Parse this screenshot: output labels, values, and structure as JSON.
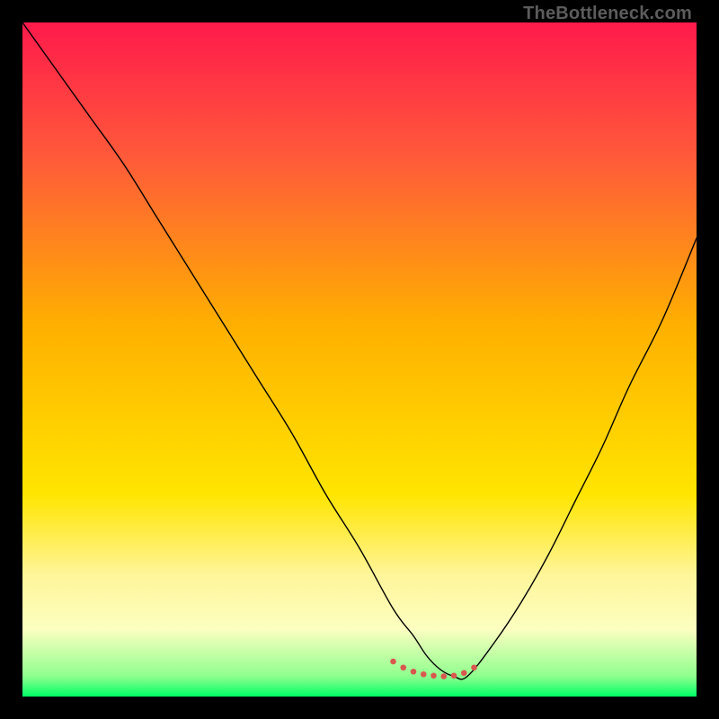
{
  "watermark": "TheBottleneck.com",
  "chart_data": {
    "type": "line",
    "title": "",
    "xlabel": "",
    "ylabel": "",
    "xlim": [
      0,
      100
    ],
    "ylim": [
      0,
      100
    ],
    "grid": false,
    "legend": false,
    "gradient_stops": [
      {
        "offset": 0.0,
        "color": "#ff1a4b"
      },
      {
        "offset": 0.2,
        "color": "#ff5a3a"
      },
      {
        "offset": 0.45,
        "color": "#ffb000"
      },
      {
        "offset": 0.7,
        "color": "#ffe500"
      },
      {
        "offset": 0.82,
        "color": "#fff59a"
      },
      {
        "offset": 0.9,
        "color": "#fcffc0"
      },
      {
        "offset": 0.97,
        "color": "#8fff8f"
      },
      {
        "offset": 1.0,
        "color": "#00ff66"
      }
    ],
    "series": [
      {
        "name": "bottleneck-curve",
        "color": "#000000",
        "width": 1.4,
        "x": [
          0,
          5,
          10,
          15,
          20,
          25,
          30,
          35,
          40,
          45,
          50,
          55,
          58,
          60,
          62,
          64,
          66,
          70,
          74,
          78,
          82,
          86,
          90,
          95,
          100
        ],
        "values": [
          100,
          93,
          86,
          79,
          71,
          63,
          55,
          47,
          39,
          30,
          22,
          13,
          9,
          6,
          4,
          3,
          3,
          8,
          14,
          21,
          29,
          37,
          46,
          56,
          68
        ]
      },
      {
        "name": "optimal-region",
        "marker": true,
        "color": "#d8584f",
        "radius": 3.3,
        "x": [
          55.0,
          56.5,
          58.0,
          59.5,
          61.0,
          62.5,
          64.0,
          65.5,
          67.0
        ],
        "values": [
          5.2,
          4.3,
          3.7,
          3.3,
          3.1,
          3.0,
          3.1,
          3.5,
          4.3
        ]
      }
    ]
  }
}
